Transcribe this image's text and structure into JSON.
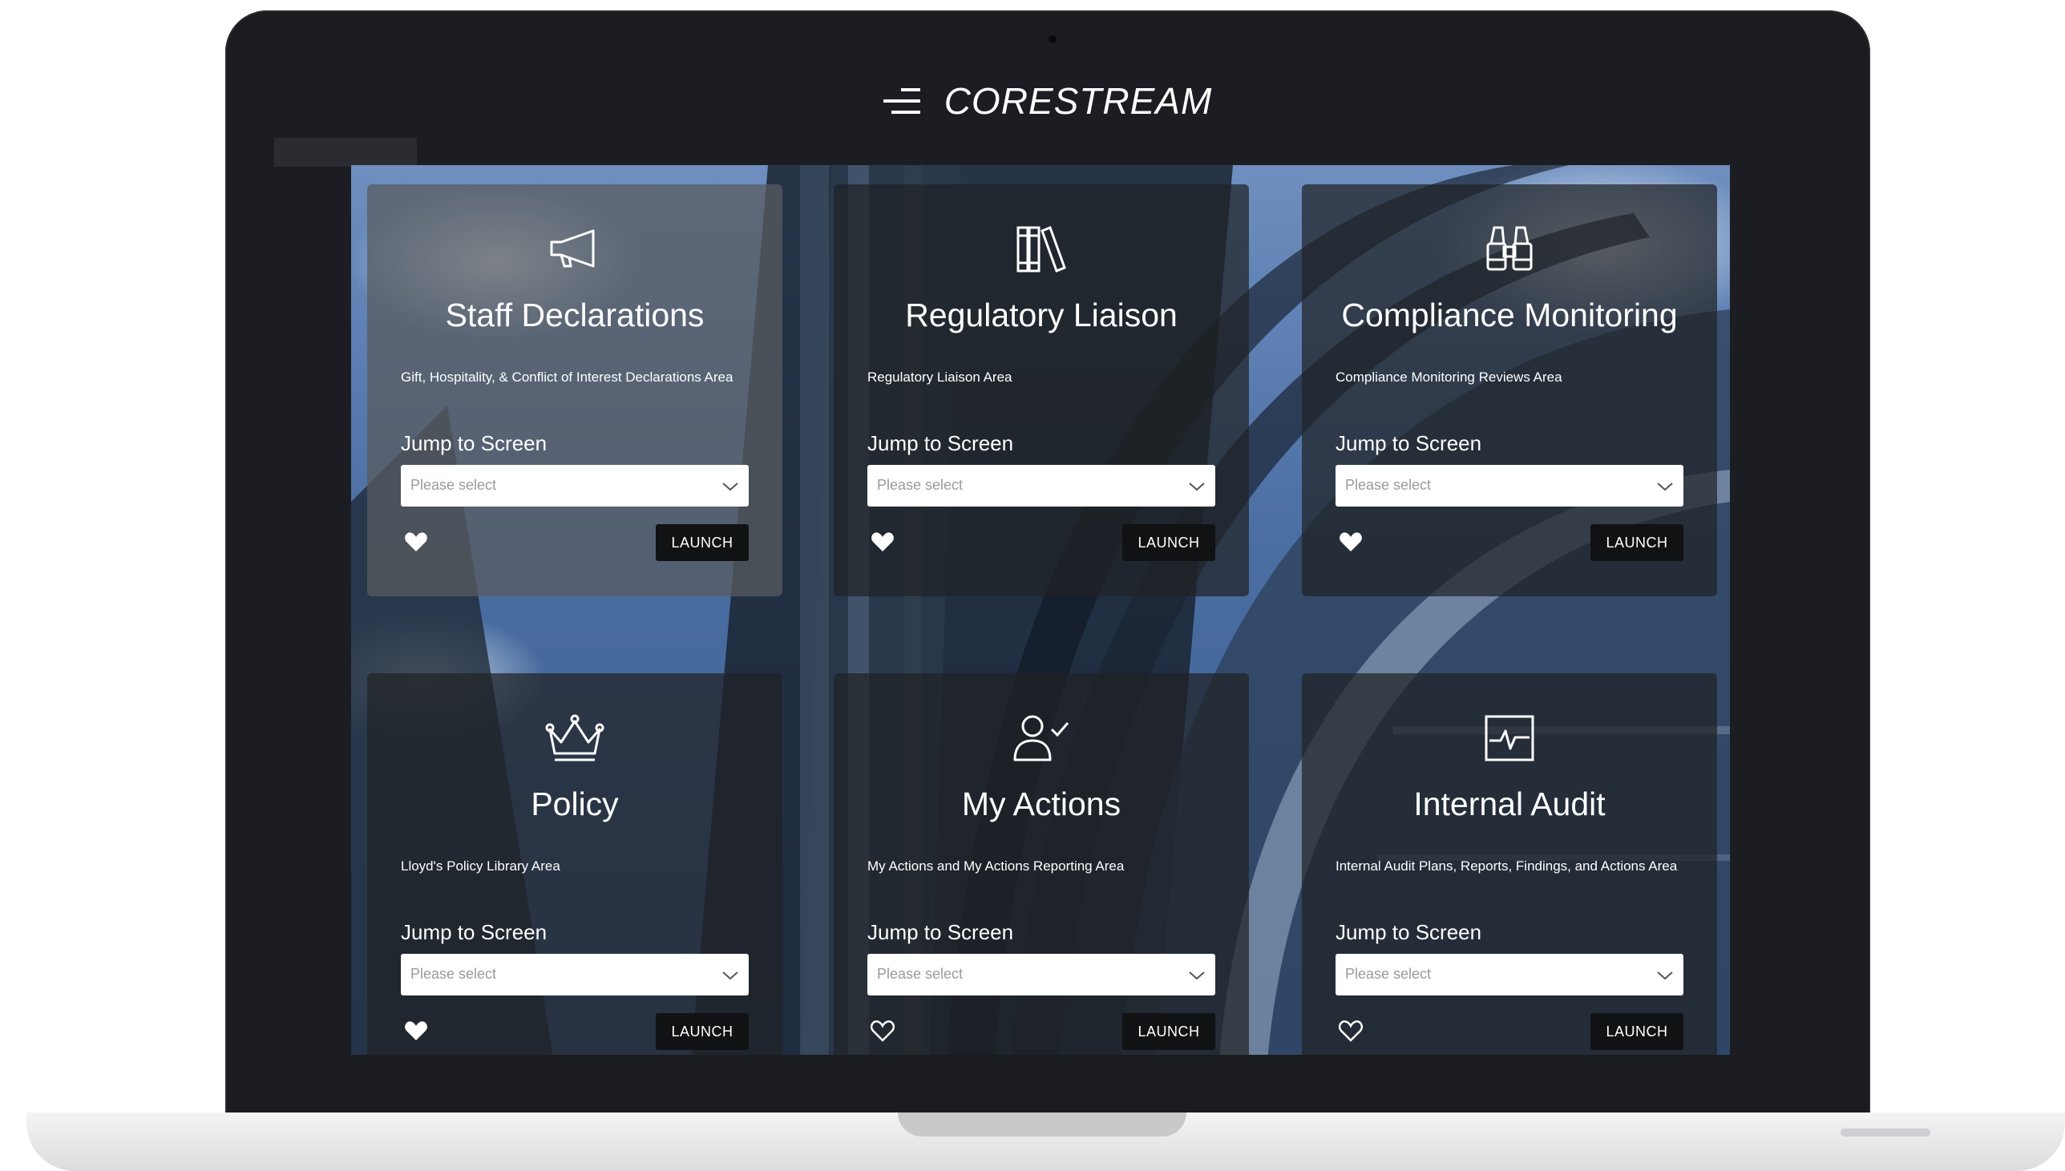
{
  "app": {
    "brand": "CORESTREAM"
  },
  "cards": [
    {
      "title": "Staff Declarations",
      "description": "Gift, Hospitality, & Conflict of Interest Declarations Area",
      "jump_label": "Jump to Screen",
      "select_placeholder": "Please select",
      "launch_label": "LAUNCH",
      "icon": "megaphone-icon",
      "favorited": true
    },
    {
      "title": "Regulatory Liaison",
      "description": "Regulatory Liaison Area",
      "jump_label": "Jump to Screen",
      "select_placeholder": "Please select",
      "launch_label": "LAUNCH",
      "icon": "books-icon",
      "favorited": true
    },
    {
      "title": "Compliance Monitoring",
      "description": "Compliance Monitoring Reviews Area",
      "jump_label": "Jump to Screen",
      "select_placeholder": "Please select",
      "launch_label": "LAUNCH",
      "icon": "binoculars-icon",
      "favorited": true
    },
    {
      "title": "Policy",
      "description": "Lloyd's Policy Library Area",
      "jump_label": "Jump to Screen",
      "select_placeholder": "Please select",
      "launch_label": "LAUNCH",
      "icon": "crown-icon",
      "favorited": true
    },
    {
      "title": "My Actions",
      "description": "My Actions and My Actions Reporting Area",
      "jump_label": "Jump to Screen",
      "select_placeholder": "Please select",
      "launch_label": "LAUNCH",
      "icon": "user-check-icon",
      "favorited": false
    },
    {
      "title": "Internal Audit",
      "description": "Internal Audit Plans, Reports, Findings, and Actions Area",
      "jump_label": "Jump to Screen",
      "select_placeholder": "Please select",
      "launch_label": "LAUNCH",
      "icon": "pulse-chart-icon",
      "favorited": false
    }
  ],
  "colors": {
    "card_dark": "#202226",
    "card_light": "#585c60",
    "launch_bg": "#111214",
    "screen_bg": "#1c1d22"
  }
}
